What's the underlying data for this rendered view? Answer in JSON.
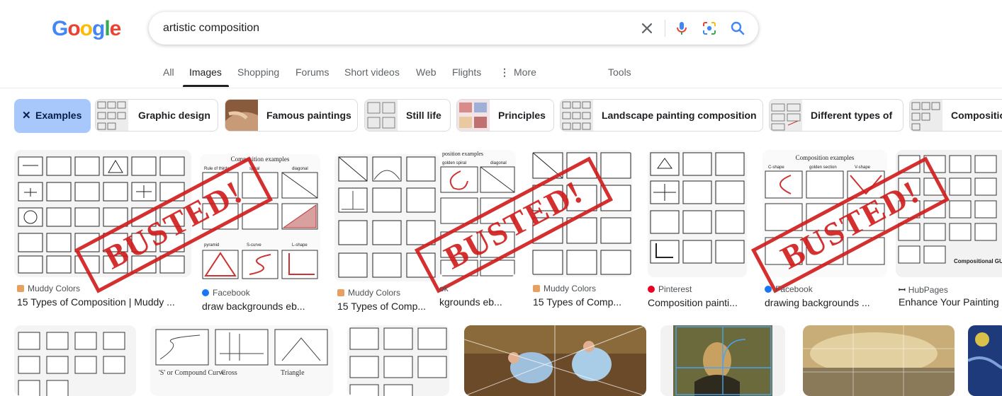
{
  "logo": {
    "letters": [
      "G",
      "o",
      "o",
      "g",
      "l",
      "e"
    ],
    "colors": [
      "#4285f4",
      "#ea4335",
      "#fbbc05",
      "#4285f4",
      "#34a853",
      "#ea4335"
    ]
  },
  "search": {
    "query": "artistic composition"
  },
  "tabs": [
    {
      "label": "All"
    },
    {
      "label": "Images"
    },
    {
      "label": "Shopping"
    },
    {
      "label": "Forums"
    },
    {
      "label": "Short videos"
    },
    {
      "label": "Web"
    },
    {
      "label": "Flights"
    },
    {
      "label": "More"
    },
    {
      "label": "Tools"
    }
  ],
  "chips": {
    "active": "Examples",
    "items": [
      "Graphic design",
      "Famous paintings",
      "Still life",
      "Principles",
      "Landscape painting composition",
      "Different types of",
      "Compositio"
    ]
  },
  "results": [
    {
      "source": "Muddy Colors",
      "title": "15 Types of Composition | Muddy ..."
    },
    {
      "source": "Facebook",
      "title": "draw backgrounds eb..."
    },
    {
      "source": "Muddy Colors",
      "title": "15 Types of Comp..."
    },
    {
      "source": "ok",
      "title": "kgrounds eb..."
    },
    {
      "source": "Muddy Colors",
      "title": "15 Types of Comp..."
    },
    {
      "source": "Pinterest",
      "title": "Composition painti..."
    },
    {
      "source": "Facebook",
      "title": "drawing backgrounds ..."
    },
    {
      "source": "HubPages",
      "title": "Enhance Your Painting"
    }
  ],
  "image_labels": {
    "card2_header": "Composition examples",
    "card2_row1": [
      "Rule of thirds",
      "spiral",
      "diagonal"
    ],
    "card2_row2": [
      "pyramid",
      "S-curve",
      "L-shape"
    ],
    "card4_header": "position examples",
    "card4_row1": [
      "golden spiral",
      "diagonal"
    ],
    "card7_header": "Composition examples",
    "card7_row1": [
      "C-shape",
      "golden section",
      "V-shape"
    ],
    "card8_footer": "Compositional GUI",
    "bottom2_captions": [
      "'S' or Compound Curve",
      "Cross",
      "Triangle"
    ]
  },
  "stamp_text": "BUSTED!",
  "colors": {
    "chip_active_bg": "#a8c7fa",
    "stamp_red": "#d11a1a",
    "link_blue": "#1a0dab"
  }
}
